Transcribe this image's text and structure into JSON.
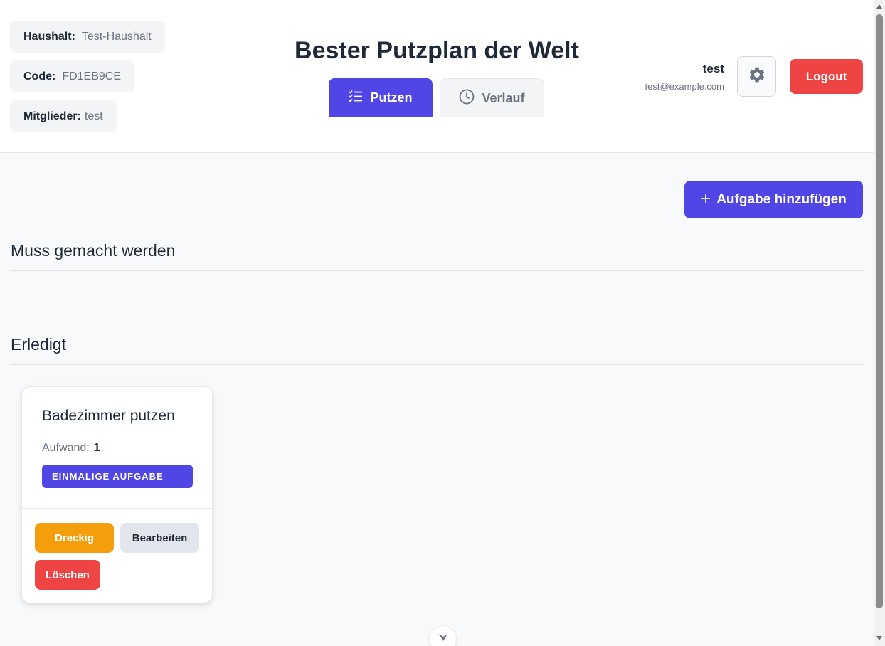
{
  "header": {
    "household_label": "Haushalt:",
    "household_value": "Test-Haushalt",
    "code_label": "Code:",
    "code_value": "FD1EB9CE",
    "members_label": "Mitglieder:",
    "members_value": "test",
    "title": "Bester Putzplan der Welt",
    "tabs": [
      {
        "label": "Putzen",
        "icon": "checklist-icon",
        "active": true
      },
      {
        "label": "Verlauf",
        "icon": "clock-icon",
        "active": false
      }
    ],
    "user": {
      "name": "test",
      "email": "test@example.com"
    },
    "settings_icon": "gear-icon",
    "logout_label": "Logout"
  },
  "main": {
    "add_task_icon": "plus-icon",
    "add_task_label": "Aufgabe hinzufügen",
    "sections": [
      {
        "title": "Muss gemacht werden"
      },
      {
        "title": "Erledigt"
      }
    ],
    "tasks_done": [
      {
        "title": "Badezimmer putzen",
        "effort_label": "Aufwand:",
        "effort_value": "1",
        "badge": "EINMALIGE AUFGABE",
        "buttons": {
          "dirty": "Dreckig",
          "edit": "Bearbeiten",
          "delete": "Löschen"
        }
      }
    ]
  },
  "colors": {
    "primary": "#4f46e5",
    "danger": "#ef4444",
    "warning": "#f59e0b",
    "neutral": "#e2e6ec"
  }
}
